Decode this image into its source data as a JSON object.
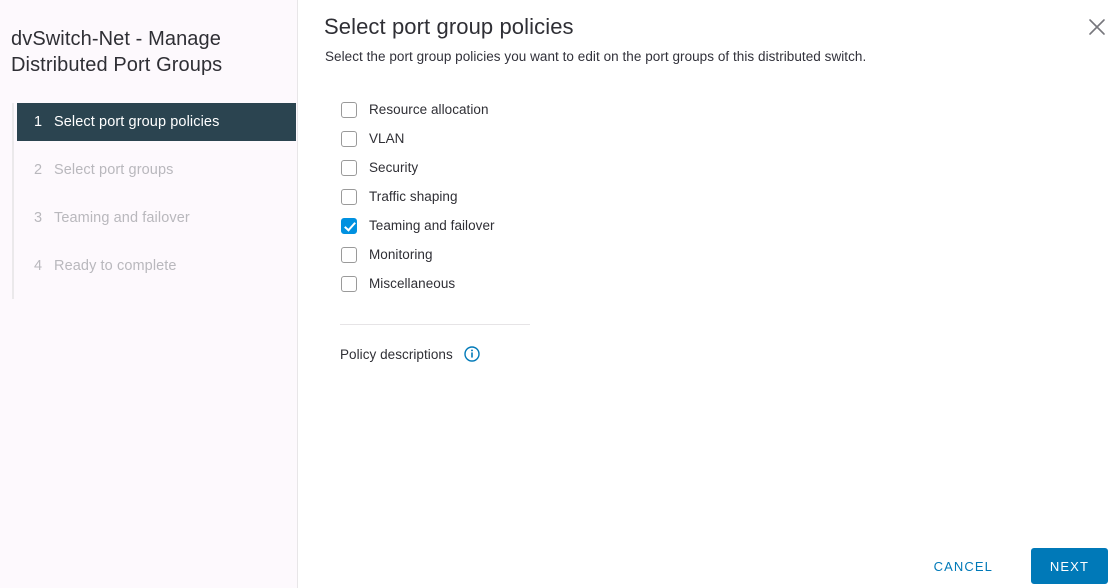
{
  "sidebar": {
    "title": "dvSwitch-Net - Manage Distributed Port Groups",
    "steps": [
      {
        "number": "1",
        "label": "Select port group policies",
        "active": true
      },
      {
        "number": "2",
        "label": "Select port groups",
        "active": false
      },
      {
        "number": "3",
        "label": "Teaming and failover",
        "active": false
      },
      {
        "number": "4",
        "label": "Ready to complete",
        "active": false
      }
    ]
  },
  "header": {
    "title": "Select port group policies",
    "subtitle": "Select the port group policies you want to edit on the port groups of this distributed switch.",
    "close_icon": "close-icon"
  },
  "policies": [
    {
      "label": "Resource allocation",
      "checked": false
    },
    {
      "label": "VLAN",
      "checked": false
    },
    {
      "label": "Security",
      "checked": false
    },
    {
      "label": "Traffic shaping",
      "checked": false
    },
    {
      "label": "Teaming and failover",
      "checked": true
    },
    {
      "label": "Monitoring",
      "checked": false
    },
    {
      "label": "Miscellaneous",
      "checked": false
    }
  ],
  "policy_descriptions": {
    "label": "Policy descriptions",
    "icon": "info-icon"
  },
  "footer": {
    "cancel_label": "CANCEL",
    "next_label": "NEXT"
  },
  "colors": {
    "accent": "#0079b8",
    "checkbox_checked": "#0091e0",
    "active_step_bg": "#2b4450",
    "sidebar_bg": "#fdf9fd",
    "inactive_step_text": "#b9b8bd"
  }
}
